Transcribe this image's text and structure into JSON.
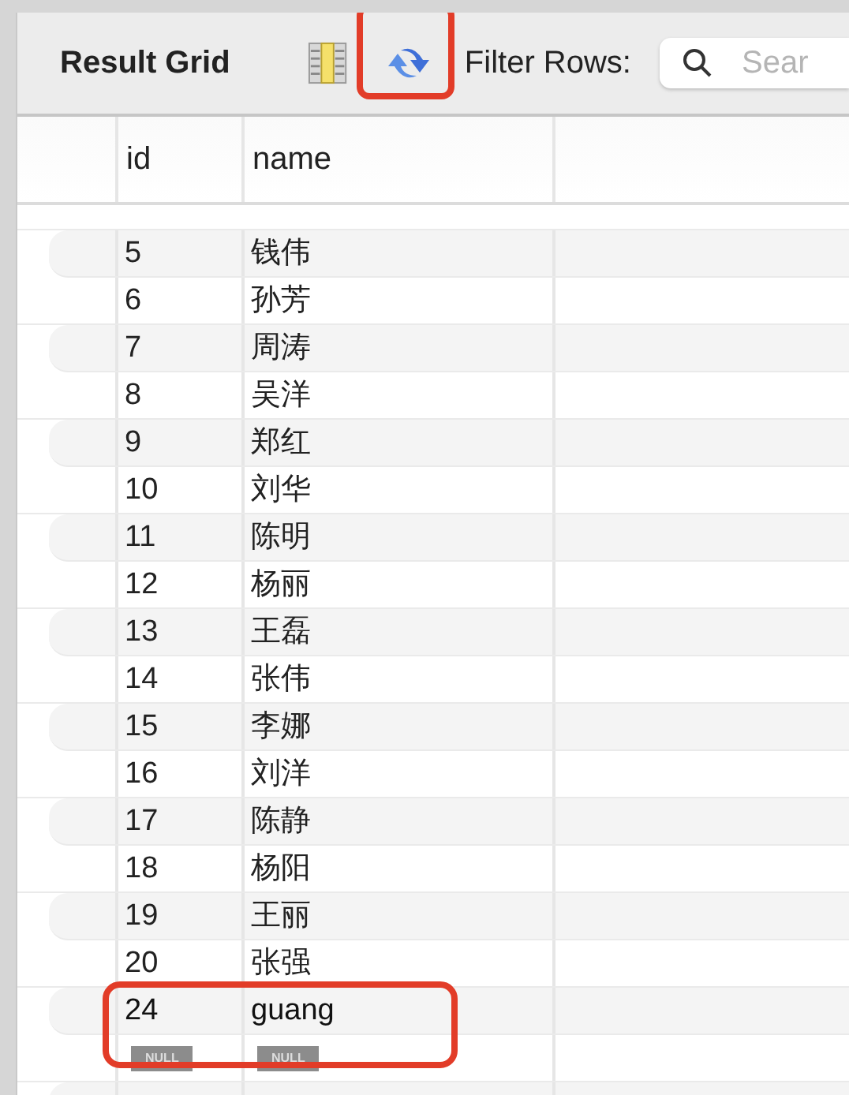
{
  "toolbar": {
    "title": "Result Grid",
    "refresh_highlighted": true,
    "filter_label": "Filter Rows:",
    "search": {
      "placeholder": "Sear"
    }
  },
  "table": {
    "columns": [
      "id",
      "name"
    ],
    "rows": [
      {
        "kind": "data",
        "id": "5",
        "name": "钱伟",
        "highlighted": false
      },
      {
        "kind": "data",
        "id": "6",
        "name": "孙芳",
        "highlighted": false
      },
      {
        "kind": "data",
        "id": "7",
        "name": "周涛",
        "highlighted": false
      },
      {
        "kind": "data",
        "id": "8",
        "name": "吴洋",
        "highlighted": false
      },
      {
        "kind": "data",
        "id": "9",
        "name": "郑红",
        "highlighted": false
      },
      {
        "kind": "data",
        "id": "10",
        "name": "刘华",
        "highlighted": false
      },
      {
        "kind": "data",
        "id": "11",
        "name": "陈明",
        "highlighted": false
      },
      {
        "kind": "data",
        "id": "12",
        "name": "杨丽",
        "highlighted": false
      },
      {
        "kind": "data",
        "id": "13",
        "name": "王磊",
        "highlighted": false
      },
      {
        "kind": "data",
        "id": "14",
        "name": "张伟",
        "highlighted": false
      },
      {
        "kind": "data",
        "id": "15",
        "name": "李娜",
        "highlighted": false
      },
      {
        "kind": "data",
        "id": "16",
        "name": "刘洋",
        "highlighted": false
      },
      {
        "kind": "data",
        "id": "17",
        "name": "陈静",
        "highlighted": false
      },
      {
        "kind": "data",
        "id": "18",
        "name": "杨阳",
        "highlighted": false
      },
      {
        "kind": "data",
        "id": "19",
        "name": "王丽",
        "highlighted": false
      },
      {
        "kind": "data",
        "id": "20",
        "name": "张强",
        "highlighted": false
      },
      {
        "kind": "data",
        "id": "24",
        "name": "guang",
        "highlighted": true
      },
      {
        "kind": "null",
        "id": "NULL",
        "name": "NULL",
        "highlighted": true
      }
    ]
  }
}
